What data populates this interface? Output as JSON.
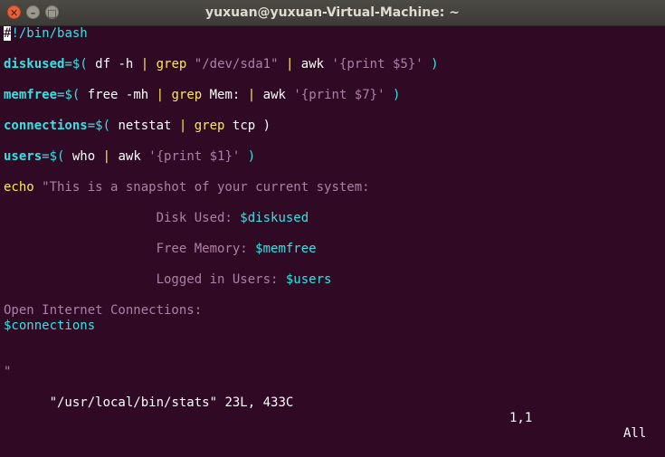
{
  "window": {
    "title": "yuxuan@yuxuan-Virtual-Machine: ~",
    "close_glyph": "✕",
    "min_glyph": "–",
    "max_glyph": "□"
  },
  "editor": {
    "line1_cursor": "#",
    "line1_rest": "!/bin/bash",
    "l2": {
      "var": "diskused",
      "eq": "=$(",
      "a": " df -h ",
      "pipe1": "|",
      "b": " ",
      "grep": "grep",
      "c": " ",
      "str": "\"/dev/sda1\"",
      "d": " ",
      "pipe2": "|",
      "e": " awk ",
      "awk": "'{print $5}'",
      "f": " )"
    },
    "l3": {
      "var": "memfree",
      "eq": "=$(",
      "a": " free -mh ",
      "pipe1": "|",
      "b": " ",
      "grep": "grep",
      "c": " Mem: ",
      "pipe2": "|",
      "e": " awk ",
      "awk": "'{print $7}'",
      "f": " )"
    },
    "l4": {
      "var": "connections",
      "eq": "=$(",
      "a": " netstat ",
      "pipe1": "|",
      "b": " ",
      "grep": "grep",
      "c": " tcp )"
    },
    "l5": {
      "var": "users",
      "eq": "=$(",
      "a": " who ",
      "pipe1": "|",
      "e": " awk ",
      "awk": "'{print $1}'",
      "f": " )"
    },
    "echo": "echo",
    "echo_str": " \"This is a snapshot of your current system:",
    "disk_label": "                    Disk Used: ",
    "disk_var": "$diskused",
    "mem_label": "                    Free Memory: ",
    "mem_var": "$memfree",
    "users_label": "                    Logged in Users: ",
    "users_var": "$users",
    "open_conn": "Open Internet Connections:",
    "conn_var": "$connections",
    "closing_quote": "\""
  },
  "status_bar": {
    "file": "\"/usr/local/bin/stats\" 23L, 433C",
    "position": "1,1",
    "scroll": "All"
  },
  "colors": {
    "background": "#300a24",
    "variable": "#34e2e2",
    "string": "#ad7fa8",
    "keyword": "#fce94f"
  }
}
